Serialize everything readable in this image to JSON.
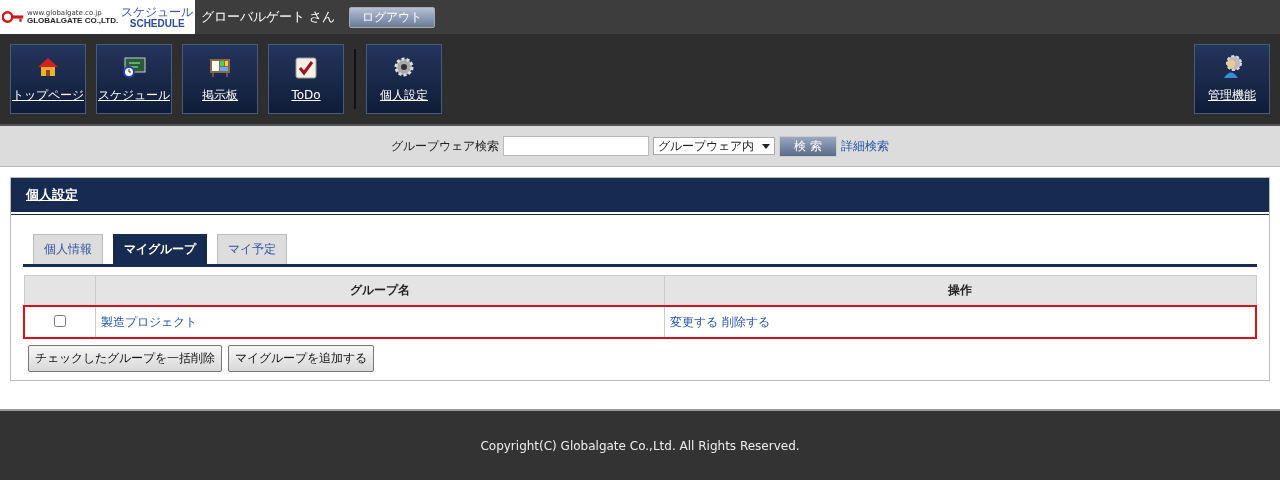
{
  "header": {
    "logo": {
      "url": "www.globalgate.co.jp",
      "company": "GLOBALGATE CO.,LTD.",
      "ruby": "スケジュール",
      "product": "SCHEDULE"
    },
    "user": "グローバルゲート さん",
    "logout": "ログアウト"
  },
  "toolbar": {
    "apps": [
      {
        "kind": "house",
        "label": "トップページ"
      },
      {
        "kind": "schedule",
        "label": "スケジュール"
      },
      {
        "kind": "board",
        "label": "掲示板"
      },
      {
        "kind": "todo",
        "label": "ToDo"
      }
    ],
    "settings": [
      {
        "kind": "gear",
        "label": "個人設定"
      }
    ],
    "admin": [
      {
        "kind": "admin",
        "label": "管理機能"
      }
    ]
  },
  "search": {
    "label": "グループウェア検索",
    "scope": "グループウェア内",
    "button": "検 索",
    "advanced": "詳細検索"
  },
  "panel": {
    "title": "個人設定",
    "tabs": [
      {
        "label": "個人情報",
        "selected": false
      },
      {
        "label": "マイグループ",
        "selected": true
      },
      {
        "label": "マイ予定",
        "selected": false
      }
    ],
    "table": {
      "columns": [
        "グループ名",
        "操作"
      ],
      "rows": [
        {
          "checked": false,
          "highlighted": true,
          "name": "製造プロジェクト",
          "actions": [
            "変更する",
            "削除する"
          ]
        }
      ]
    },
    "buttons": [
      "チェックしたグループを一括削除",
      "マイグループを追加する"
    ]
  },
  "footer": "Copyright(C) Globalgate Co.,Ltd. All Rights Reserved."
}
